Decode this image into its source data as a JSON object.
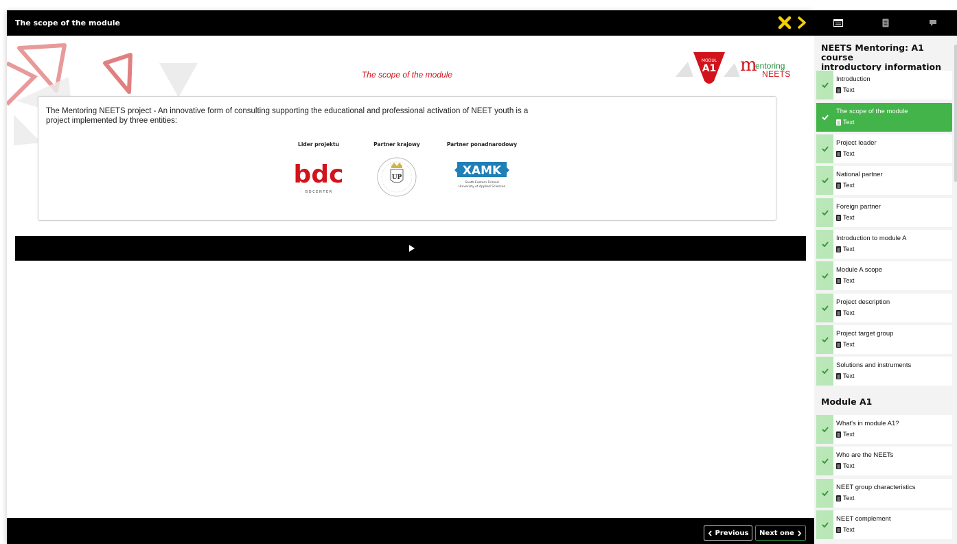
{
  "viewer": {
    "title": "The scope of the module",
    "slide_title": "The scope of the module",
    "module_logo": {
      "top": "MODUŁ",
      "code": "A1"
    },
    "brand_logo": {
      "m": "m",
      "entoring": "entoring",
      "neets": "NEETS"
    },
    "intro_text": "The Mentoring NEETS project - An innovative form of consulting supporting the educational and professional activation of NEET youth is a project implemented by three entities:",
    "partners": [
      {
        "label": "Lider projektu",
        "logo_text": "bdc",
        "logo_sub": "B D   C E N T E R"
      },
      {
        "label": "Partner krajowy",
        "logo_text": "UP"
      },
      {
        "label": "Partner ponadnarodowy",
        "logo_text": "XAMK",
        "logo_sub1": "South-Eastern Finland",
        "logo_sub2": "University of Applied Sciences"
      }
    ],
    "buttons": {
      "previous": "Previous",
      "next": "Next one"
    }
  },
  "sidebar": {
    "section1_title_line1": "NEETS Mentoring: A1 course",
    "section1_title_line2": "introductory information",
    "section2_title": "Module A1",
    "items": [
      {
        "label": "Introduction",
        "type": "Text"
      },
      {
        "label": "The scope of the module",
        "type": "Text"
      },
      {
        "label": "Project leader",
        "type": "Text"
      },
      {
        "label": "National partner",
        "type": "Text"
      },
      {
        "label": "Foreign partner",
        "type": "Text"
      },
      {
        "label": "Introduction to module A",
        "type": "Text"
      },
      {
        "label": "Module A scope",
        "type": "Text"
      },
      {
        "label": "Project description",
        "type": "Text"
      },
      {
        "label": "Project target group",
        "type": "Text"
      },
      {
        "label": "Solutions and instruments",
        "type": "Text"
      },
      {
        "label": "What's in module A1?",
        "type": "Text"
      },
      {
        "label": "Who are the NEETs",
        "type": "Text"
      },
      {
        "label": "NEET group characteristics",
        "type": "Text"
      },
      {
        "label": "NEET complement",
        "type": "Text"
      }
    ]
  },
  "colors": {
    "accent_green": "#43b449",
    "completed_green": "#b9e7b7",
    "brand_red": "#d3131b",
    "highlight_yellow": "#f4d000"
  }
}
